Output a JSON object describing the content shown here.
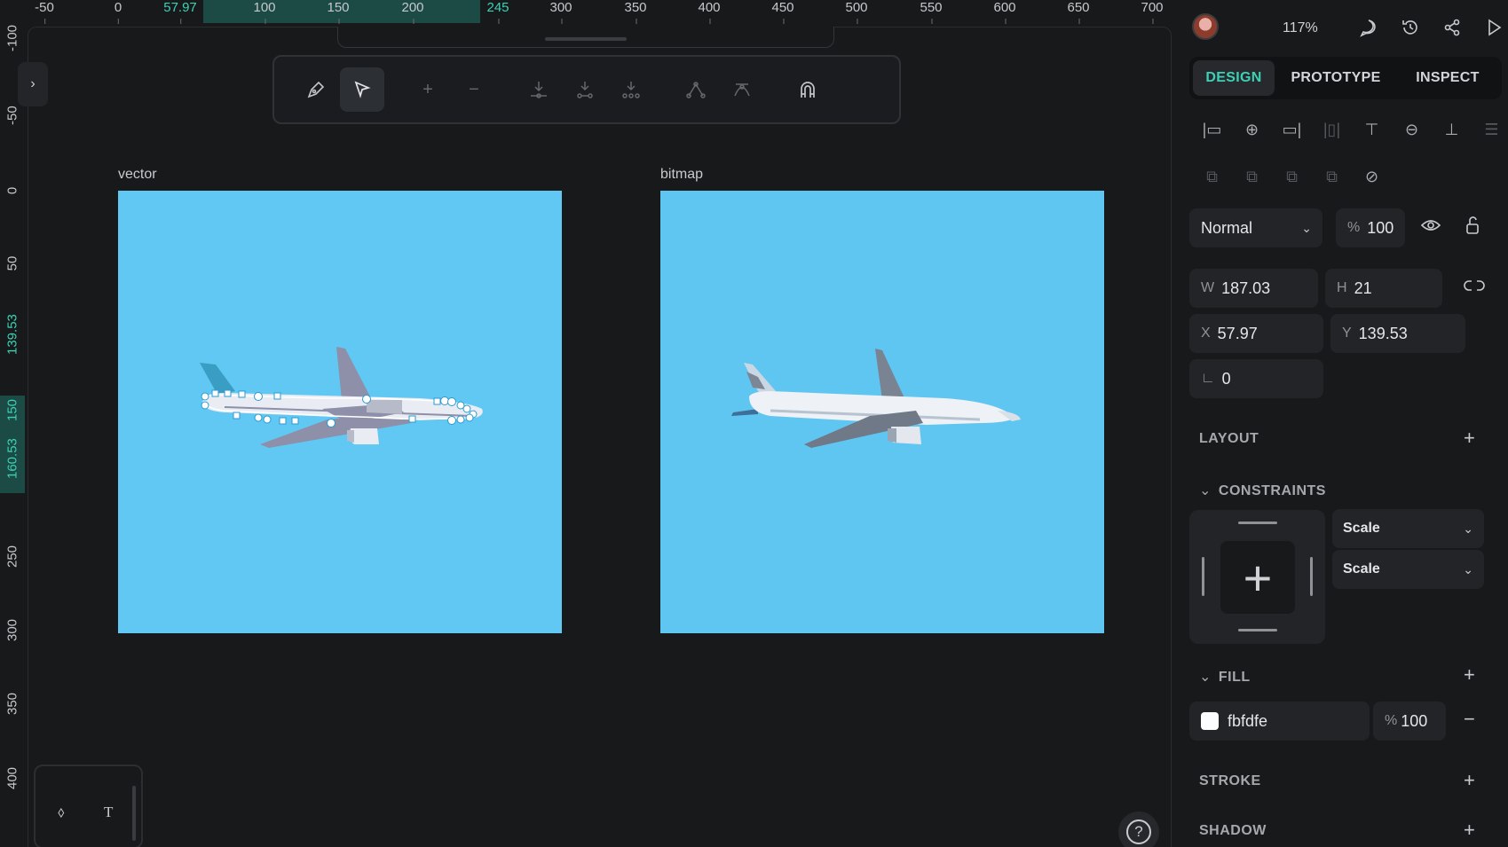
{
  "ruler": {
    "top_ticks": [
      "-50",
      "0",
      "57.97",
      "100",
      "150",
      "200",
      "245",
      "300",
      "350",
      "400",
      "450",
      "500",
      "550",
      "600",
      "650",
      "700"
    ],
    "left_ticks": [
      "-100",
      "-50",
      "0",
      "50",
      "139.53",
      "150",
      "160.53",
      "250",
      "300",
      "350",
      "400"
    ]
  },
  "canvas": {
    "boards": [
      {
        "label": "vector"
      },
      {
        "label": "bitmap"
      }
    ],
    "bottom_tools": {
      "drop_glyph": "⬨",
      "text_glyph": "T"
    },
    "help_glyph": "?"
  },
  "toolbar": {
    "tools": [
      "pen-tool",
      "select-tool",
      "add-node",
      "remove-node",
      "merge-nodes",
      "join-nodes",
      "separate-nodes",
      "make-corner",
      "make-curve",
      "snap-nodes"
    ]
  },
  "header": {
    "zoom": "117%"
  },
  "tabs": [
    "DESIGN",
    "PROTOTYPE",
    "INSPECT"
  ],
  "layer": {
    "blend_mode": "Normal",
    "opacity_symbol": "%",
    "opacity": "100"
  },
  "measures": {
    "w_label": "W",
    "w": "187.03",
    "h_label": "H",
    "h": "21",
    "x_label": "X",
    "x": "57.97",
    "y_label": "Y",
    "y": "139.53",
    "radius": "0"
  },
  "sections": {
    "layout": "LAYOUT",
    "constraints": "CONSTRAINTS",
    "fill": "FILL",
    "stroke": "STROKE",
    "shadow": "SHADOW"
  },
  "constraints": {
    "horizontal": "Scale",
    "vertical": "Scale"
  },
  "fill": {
    "color_hex": "fbfdfe",
    "opacity_symbol": "%",
    "opacity": "100"
  },
  "colors": {
    "accent": "#3cd1b6",
    "board_bg": "#61c7f3",
    "fill_swatch": "#fbfdfe"
  }
}
